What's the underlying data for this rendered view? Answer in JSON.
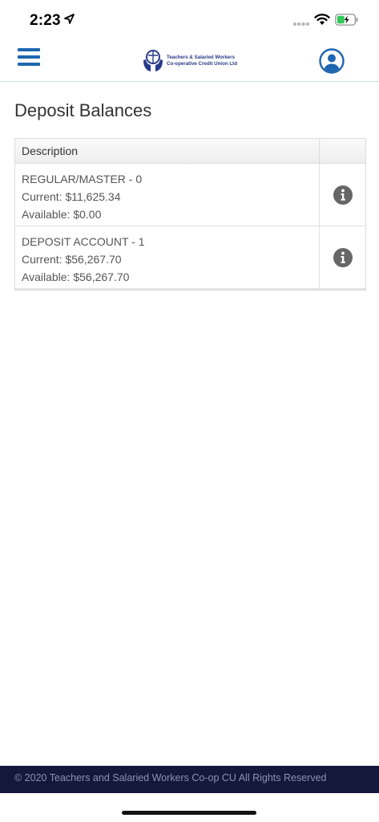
{
  "status": {
    "time": "2:23"
  },
  "header": {
    "logo_line1": "Teachers & Salaried Workers",
    "logo_line2": "Co-operative Credit Union Ltd"
  },
  "page": {
    "title": "Deposit Balances"
  },
  "table": {
    "column_description": "Description",
    "accounts": [
      {
        "name": "REGULAR/MASTER - 0",
        "current": "Current: $11,625.34",
        "available": "Available: $0.00"
      },
      {
        "name": "DEPOSIT ACCOUNT - 1",
        "current": "Current: $56,267.70",
        "available": "Available: $56,267.70"
      }
    ]
  },
  "footer": {
    "copyright": "© 2020 Teachers and Salaried Workers Co-op CU All Rights Reserved"
  },
  "icons": [
    "menu-icon",
    "credit-union-logo",
    "user-profile-icon",
    "info-icon",
    "location-arrow-icon",
    "wifi-icon",
    "battery-icon"
  ],
  "colors": {
    "brand_blue": "#1f66b0",
    "footer_bg": "#14183a",
    "info_icon": "#666666"
  }
}
